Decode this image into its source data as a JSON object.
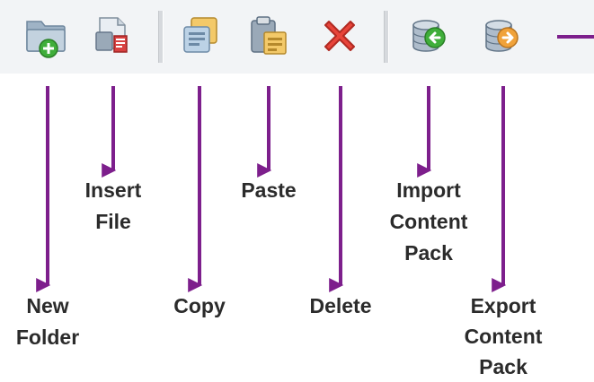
{
  "toolbar": {
    "buttons": [
      {
        "id": "new-folder",
        "icon": "new-folder-icon"
      },
      {
        "id": "insert-file",
        "icon": "insert-file-icon"
      },
      {
        "id": "copy",
        "icon": "copy-icon"
      },
      {
        "id": "paste",
        "icon": "paste-icon"
      },
      {
        "id": "delete",
        "icon": "delete-icon"
      },
      {
        "id": "import-content-pack",
        "icon": "import-content-pack-icon"
      },
      {
        "id": "export-content-pack",
        "icon": "export-content-pack-icon"
      }
    ]
  },
  "labels": {
    "new_folder": [
      "New",
      "Folder"
    ],
    "insert_file": [
      "Insert",
      "File"
    ],
    "copy": [
      "Copy"
    ],
    "paste": [
      "Paste"
    ],
    "delete": [
      "Delete"
    ],
    "import_content_pack": [
      "Import",
      "Content",
      "Pack"
    ],
    "export_content_pack": [
      "Export",
      "Content",
      "Pack"
    ]
  },
  "colors": {
    "arrow": "#7d1f8c",
    "toolbar_bg": "#f2f4f6",
    "label_text": "#2b2b2b",
    "delete_red": "#e8443a",
    "accent_green": "#3fae3a",
    "accent_orange": "#f0a23a"
  }
}
